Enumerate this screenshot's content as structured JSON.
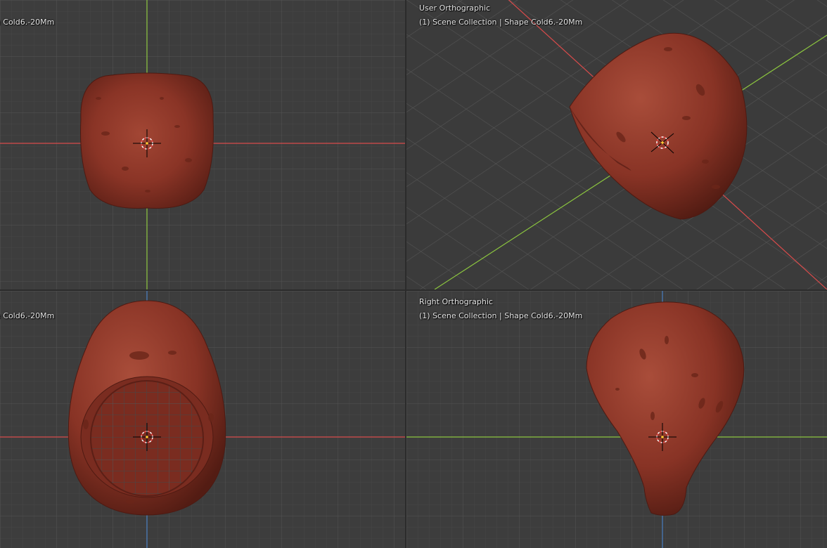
{
  "viewports": {
    "top_left": {
      "title": "",
      "info": "e Cold6.-20Mm"
    },
    "top_right": {
      "title": "User Orthographic",
      "info": "(1) Scene Collection | Shape Cold6.-20Mm"
    },
    "bottom_left": {
      "title": "",
      "info": "e Cold6.-20Mm"
    },
    "bottom_right": {
      "title": "Right Orthographic",
      "info": "(1) Scene Collection | Shape Cold6.-20Mm"
    }
  },
  "colors": {
    "background": "#3d3d3d",
    "grid_minor": "#474747",
    "grid_major": "#545454",
    "axis_x": "#d94b4b",
    "axis_y": "#8cc63f",
    "axis_z": "#4a7fc1",
    "model": "#8a3426",
    "model_highlight": "#a84a38",
    "model_shadow": "#4e1a12"
  },
  "icons": {
    "cursor": "3d-cursor-icon"
  }
}
